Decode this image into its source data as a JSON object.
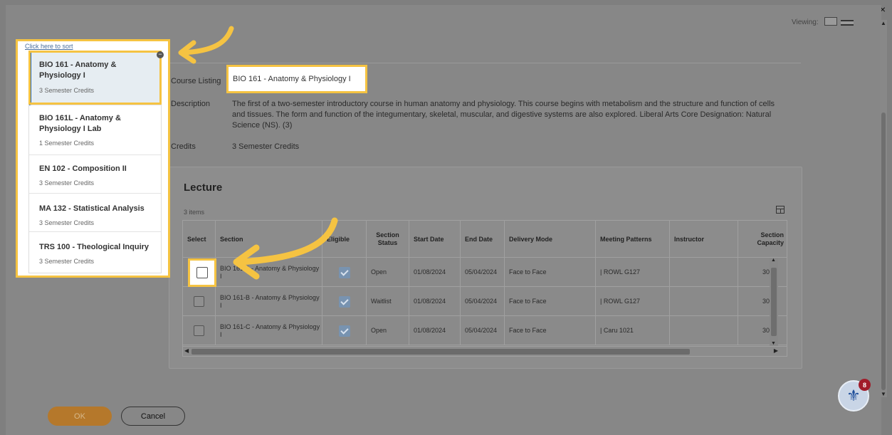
{
  "window": {
    "close_glyph": "×"
  },
  "viewing": {
    "label": "Viewing:"
  },
  "sort_panel": {
    "hint": "Click here to sort",
    "items": [
      {
        "title": "BIO 161 - Anatomy & Physiology I",
        "credits": "3 Semester Credits",
        "selected": true
      },
      {
        "title": "BIO 161L - Anatomy & Physiology I Lab",
        "credits": "1 Semester Credits",
        "selected": false
      },
      {
        "title": "EN 102 - Composition II",
        "credits": "3 Semester Credits",
        "selected": false
      },
      {
        "title": "MA 132 - Statistical Analysis",
        "credits": "3 Semester Credits",
        "selected": false
      },
      {
        "title": "TRS 100 - Theological Inquiry",
        "credits": "3 Semester Credits",
        "selected": false
      }
    ]
  },
  "course": {
    "listing_label": "Course Listing",
    "listing_value": "BIO 161 - Anatomy & Physiology I",
    "description_label": "Description",
    "description_value": "The first of a two-semester introductory course in human anatomy and physiology. This course begins with metabolism and the structure and function of cells and tissues. The form and function of the integumentary, skeletal, muscular, and digestive systems are also explored. Liberal Arts Core Designation: Natural Science (NS). (3)",
    "credits_label": "Credits",
    "credits_value": "3 Semester Credits"
  },
  "lecture": {
    "title": "Lecture",
    "items_count": "3 items",
    "columns": {
      "select": "Select",
      "section": "Section",
      "eligible": "Eligible",
      "section_status": "Section Status",
      "start_date": "Start Date",
      "end_date": "End Date",
      "delivery_mode": "Delivery Mode",
      "meeting_patterns": "Meeting Patterns",
      "instructor": "Instructor",
      "section_capacity": "Section Capacity"
    },
    "rows": [
      {
        "section": "BIO 161-A - Anatomy & Physiology I",
        "status": "Open",
        "start": "01/08/2024",
        "end": "05/04/2024",
        "mode": "Face to Face",
        "pattern": "| ROWL G127",
        "instructor": "",
        "capacity": "30"
      },
      {
        "section": "BIO 161-B - Anatomy & Physiology I",
        "status": "Waitlist",
        "start": "01/08/2024",
        "end": "05/04/2024",
        "mode": "Face to Face",
        "pattern": "| ROWL G127",
        "instructor": "",
        "capacity": "30"
      },
      {
        "section": "BIO 161-C - Anatomy & Physiology I",
        "status": "Open",
        "start": "01/08/2024",
        "end": "05/04/2024",
        "mode": "Face to Face",
        "pattern": "| Caru 1021",
        "instructor": "",
        "capacity": "30"
      }
    ]
  },
  "footer": {
    "ok_label": "OK",
    "cancel_label": "Cancel"
  },
  "help": {
    "badge_count": "8"
  },
  "colors": {
    "highlight": "#f5c342",
    "selected_accent": "#1f5fa8",
    "ok_button": "#b5782b"
  }
}
